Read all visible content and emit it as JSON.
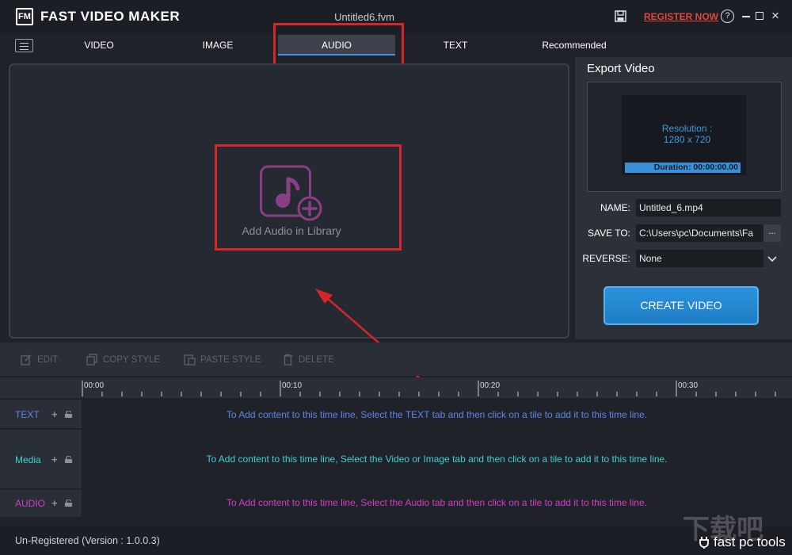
{
  "app": {
    "logo_text": "FM",
    "title": "FAST VIDEO MAKER",
    "document": "Untitled6.fvm",
    "register_label": "REGISTER NOW",
    "help_label": "?",
    "close_label": "×"
  },
  "tabs": [
    {
      "label": "VIDEO",
      "active": false
    },
    {
      "label": "IMAGE",
      "active": false
    },
    {
      "label": "AUDIO",
      "active": true
    },
    {
      "label": "TEXT",
      "active": false
    },
    {
      "label": "Recommended",
      "active": false
    }
  ],
  "preview": {
    "add_audio_label": "Add Audio in Library",
    "icon": "music-note-add-icon"
  },
  "export": {
    "title": "Export Video",
    "resolution_label": "Resolution :",
    "resolution_value": "1280 x 720",
    "duration_label": "Duration: 00:00:00.00",
    "name_label": "NAME:",
    "name_value": "Untitled_6.mp4",
    "save_to_label": "SAVE TO:",
    "save_to_value": "C:\\Users\\pc\\Documents\\Fa",
    "browse_label": "...",
    "reverse_label": "REVERSE:",
    "reverse_value": "None",
    "create_label": "CREATE VIDEO"
  },
  "toolbar": {
    "edit": "EDIT",
    "copy_style": "COPY STYLE",
    "paste_style": "PASTE STYLE",
    "delete": "DELETE"
  },
  "ruler": [
    "00:00",
    "00:10",
    "00:20",
    "00:30"
  ],
  "tracks": [
    {
      "label": "TEXT",
      "color": "#5b86e6",
      "message": "To Add content to this time line, Select the TEXT tab and then click on a tile to add it to this time line."
    },
    {
      "label": "Media",
      "color": "#3fd0d2",
      "message": "To Add content to this time line, Select the Video or Image tab and then click on a tile to add it to this time line."
    },
    {
      "label": "AUDIO",
      "color": "#d13ec9",
      "message": "To Add content to this time line, Select the Audio tab and then click on a tile to add it to this time line."
    }
  ],
  "track_plus_label": "+",
  "status": {
    "version_text": "Un-Registered (Version : 1.0.0.3)",
    "brand_text": "fast pc tools",
    "watermark_text": "下载吧"
  },
  "colors": {
    "accent": "#3b97e0",
    "highlight": "#d8252a",
    "register": "#e0473c",
    "audio_icon": "#8a3f84"
  }
}
